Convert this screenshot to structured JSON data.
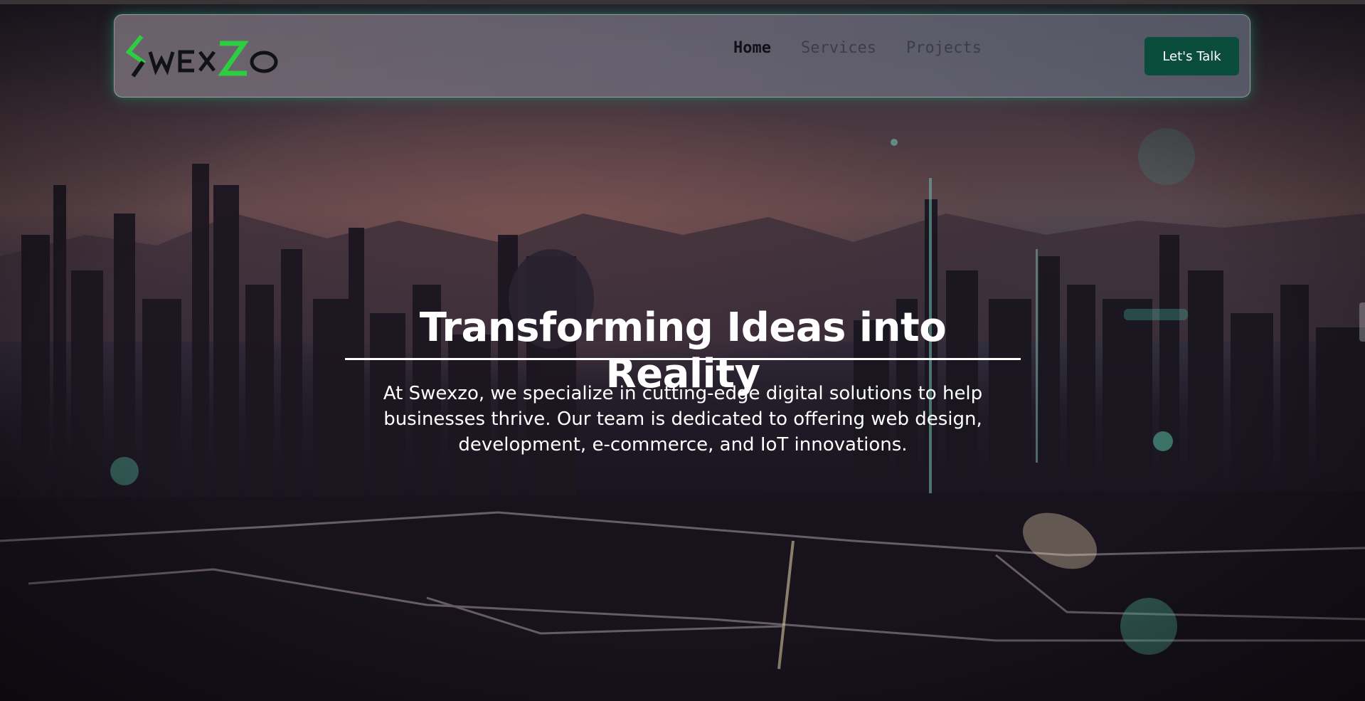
{
  "brand": {
    "logo_alt": "Swexzo",
    "accent": "#2ecc40",
    "dark": "#111218"
  },
  "nav": {
    "items": [
      {
        "label": "Home",
        "active": true
      },
      {
        "label": "Services",
        "active": false
      },
      {
        "label": "Projects",
        "active": false
      }
    ],
    "cta_label": "Let's Talk",
    "cta_color": "#0b4d3d"
  },
  "hero": {
    "title": "Transforming Ideas into Reality",
    "description": "At Swexzo, we specialize in cutting-edge digital solutions to help businesses thrive. Our team is dedicated to offering web design, development, e-commerce, and IoT innovations."
  }
}
